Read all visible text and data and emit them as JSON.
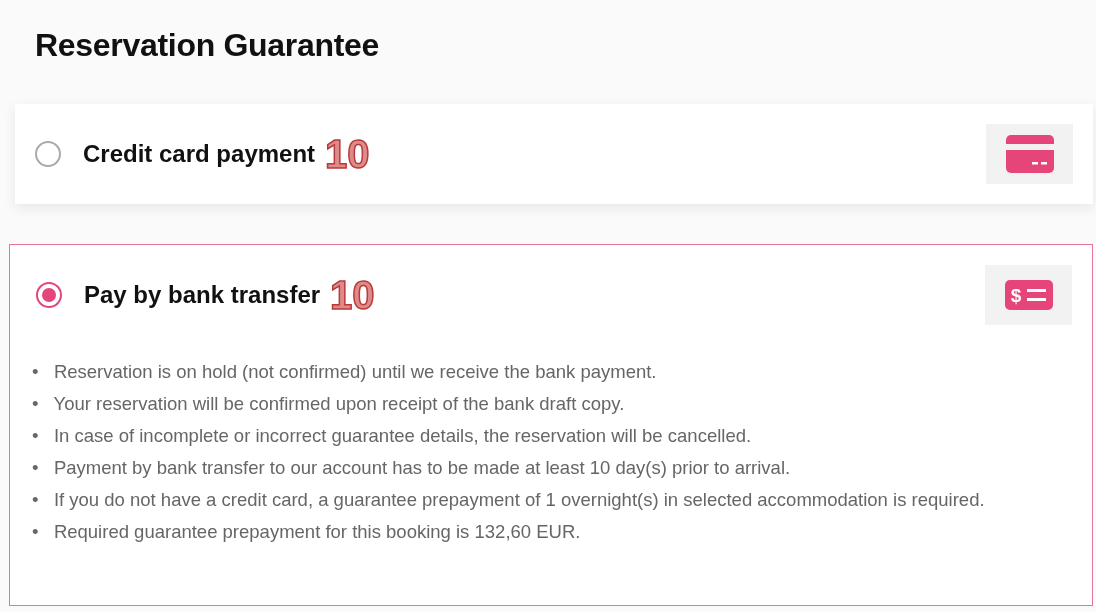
{
  "title": "Reservation Guarantee",
  "options": [
    {
      "label": "Credit card payment",
      "marker": "10",
      "selected": false,
      "kind": "card"
    },
    {
      "label": "Pay by bank transfer",
      "marker": "10",
      "selected": true,
      "kind": "bank",
      "icon_symbol": "$",
      "notes": [
        "•   Reservation is on hold (not confirmed) until we receive the bank payment.",
        "•   Your reservation will be confirmed upon receipt of the bank draft copy.",
        "•   In case of incomplete or incorrect guarantee details, the reservation will be cancelled.",
        "•   Payment by bank transfer to our account has to be made at least 10 day(s) prior to arrival.",
        "•   If you do not have a credit card, a guarantee prepayment of 1 overnight(s) in selected accommodation is required.",
        "•   Required guarantee prepayment for this booking is 132,60 EUR."
      ]
    }
  ]
}
